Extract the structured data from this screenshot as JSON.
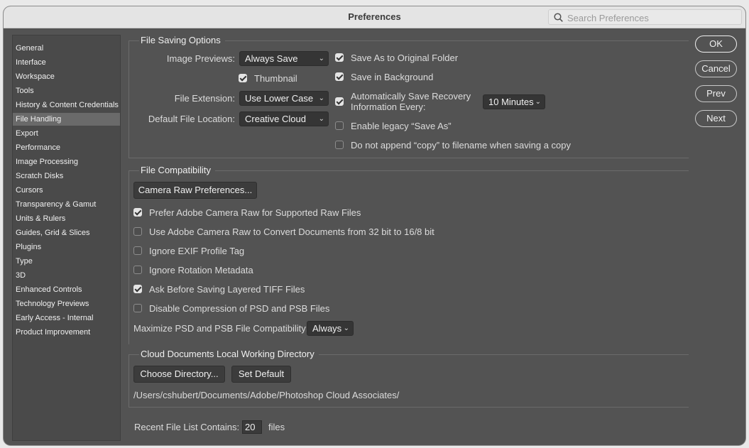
{
  "window": {
    "title": "Preferences"
  },
  "search": {
    "placeholder": "Search Preferences"
  },
  "sidebar": {
    "items": [
      {
        "label": "General"
      },
      {
        "label": "Interface"
      },
      {
        "label": "Workspace"
      },
      {
        "label": "Tools"
      },
      {
        "label": "History & Content Credentials"
      },
      {
        "label": "File Handling"
      },
      {
        "label": "Export"
      },
      {
        "label": "Performance"
      },
      {
        "label": "Image Processing"
      },
      {
        "label": "Scratch Disks"
      },
      {
        "label": "Cursors"
      },
      {
        "label": "Transparency & Gamut"
      },
      {
        "label": "Units & Rulers"
      },
      {
        "label": "Guides, Grid & Slices"
      },
      {
        "label": "Plugins"
      },
      {
        "label": "Type"
      },
      {
        "label": "3D"
      },
      {
        "label": "Enhanced Controls"
      },
      {
        "label": "Technology Previews"
      },
      {
        "label": "Early Access - Internal"
      },
      {
        "label": "Product Improvement"
      }
    ],
    "selected": "File Handling"
  },
  "file_saving": {
    "title": "File Saving Options",
    "image_previews_label": "Image Previews:",
    "image_previews_value": "Always Save",
    "thumbnail_label": "Thumbnail",
    "file_extension_label": "File Extension:",
    "file_extension_value": "Use Lower Case",
    "default_location_label": "Default File Location:",
    "default_location_value": "Creative Cloud",
    "save_as_original_label": "Save As to Original Folder",
    "save_background_label": "Save in Background",
    "auto_save_label_1": "Automatically Save Recovery",
    "auto_save_label_2": "Information Every:",
    "auto_save_value": "10 Minutes",
    "legacy_save_as_label": "Enable legacy “Save As”",
    "no_copy_label": "Do not append “copy” to filename when saving a copy"
  },
  "file_compat": {
    "title": "File Compatibility",
    "camera_raw_button": "Camera Raw Preferences...",
    "options": [
      {
        "label": "Prefer Adobe Camera Raw for Supported Raw Files",
        "checked": true
      },
      {
        "label": "Use Adobe Camera Raw to Convert Documents from 32 bit to 16/8 bit",
        "checked": false
      },
      {
        "label": "Ignore EXIF Profile Tag",
        "checked": false
      },
      {
        "label": "Ignore Rotation Metadata",
        "checked": false
      },
      {
        "label": "Ask Before Saving Layered TIFF Files",
        "checked": true
      },
      {
        "label": "Disable Compression of PSD and PSB Files",
        "checked": false
      }
    ],
    "maximize_label": "Maximize PSD and PSB File Compatibility:",
    "maximize_value": "Always"
  },
  "cloud_docs": {
    "title": "Cloud Documents Local Working Directory",
    "choose_button": "Choose Directory...",
    "default_button": "Set Default",
    "path": "/Users/cshubert/Documents/Adobe/Photoshop Cloud Associates/"
  },
  "recent": {
    "label": "Recent File List Contains:",
    "value": "20",
    "suffix": "files"
  },
  "buttons": {
    "ok": "OK",
    "cancel": "Cancel",
    "prev": "Prev",
    "next": "Next"
  }
}
